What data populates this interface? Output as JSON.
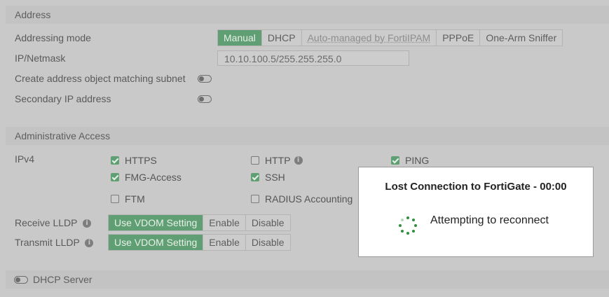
{
  "address": {
    "section_title": "Address",
    "addressing_mode_label": "Addressing mode",
    "modes": [
      "Manual",
      "DHCP",
      "Auto-managed by FortiIPAM",
      "PPPoE",
      "One-Arm Sniffer"
    ],
    "active_mode": "Manual",
    "ip_label": "IP/Netmask",
    "ip_value": "10.10.100.5/255.255.255.0",
    "create_object_label": "Create address object matching subnet",
    "secondary_ip_label": "Secondary IP address"
  },
  "admin_access": {
    "section_title": "Administrative Access",
    "ipv4_label": "IPv4",
    "https": "HTTPS",
    "http": "HTTP",
    "ping": "PING",
    "fmg_access": "FMG-Access",
    "ssh": "SSH",
    "ftm": "FTM",
    "radius": "RADIUS Accounting"
  },
  "lldp": {
    "receive_label": "Receive LLDP",
    "transmit_label": "Transmit LLDP",
    "options": [
      "Use VDOM Setting",
      "Enable",
      "Disable"
    ],
    "active": "Use VDOM Setting"
  },
  "dhcp": {
    "server_label": "DHCP Server"
  },
  "modal": {
    "title": "Lost Connection to FortiGate - 00:00",
    "message": "Attempting to reconnect"
  },
  "colors": {
    "accent": "#5f9f73",
    "spinner": "#2f8f3f",
    "overlay_bg": "#c9c9c9"
  },
  "icons": {
    "info": "info-icon",
    "toggle": "toggle-icon",
    "spinner": "spinner-icon"
  }
}
